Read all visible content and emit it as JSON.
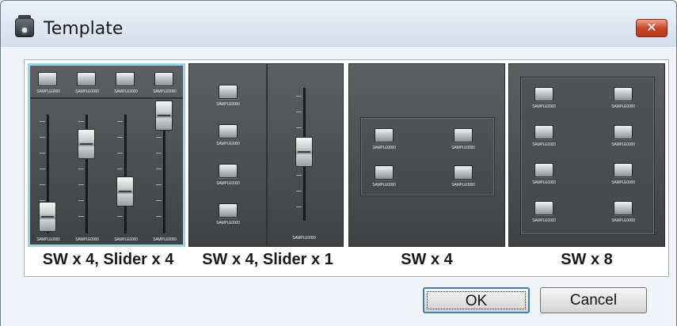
{
  "window": {
    "title": "Template",
    "close_label": "✕"
  },
  "templates": [
    {
      "caption": "SW x 4, Slider x 4",
      "switch_label": "SAMPLE0000",
      "slider_label": "SAMPLE0000"
    },
    {
      "caption": "SW x 4, Slider x 1",
      "switch_label": "SAMPLE0000",
      "slider_label": "SAMPLE0000"
    },
    {
      "caption": "SW x 4",
      "switch_label": "SAMPLE0000"
    },
    {
      "caption": "SW x 8",
      "switch_label": "SAMPLE0000"
    }
  ],
  "buttons": {
    "ok": "OK",
    "cancel": "Cancel"
  }
}
